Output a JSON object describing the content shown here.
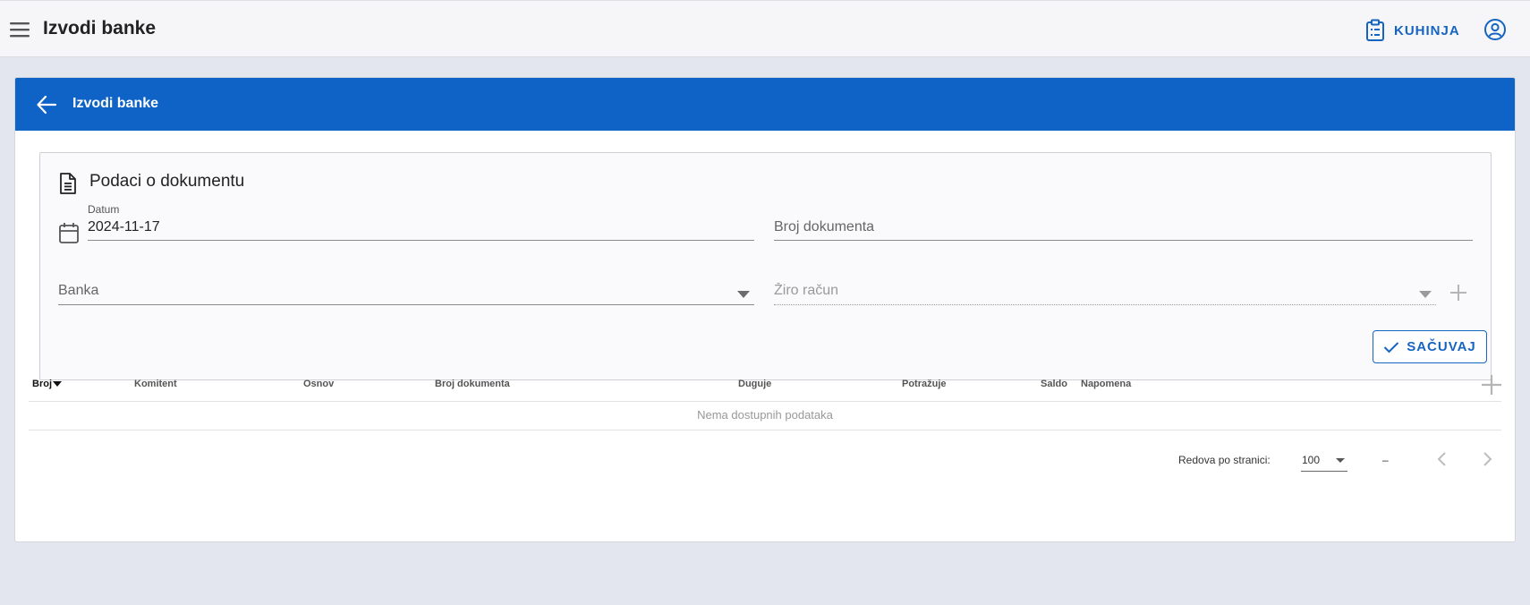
{
  "appbar": {
    "title": "Izvodi banke",
    "location_label": "KUHINJA",
    "icons": {
      "menu": "hamburger-menu-icon",
      "location": "clipboard-list-icon",
      "account": "account-circle-icon"
    }
  },
  "card": {
    "title": "Izvodi banke",
    "back_icon": "arrow-left-icon"
  },
  "document": {
    "title": "Podaci o dokumentu",
    "fields": {
      "datum": {
        "label": "Datum",
        "value": "2024-11-17"
      },
      "broj_dokumenta": {
        "placeholder": "Broj dokumenta",
        "value": ""
      },
      "banka": {
        "placeholder": "Banka",
        "value": ""
      },
      "ziro_racun": {
        "placeholder": "Žiro račun",
        "value": "",
        "disabled": true
      }
    },
    "save_label": "SAČUVAJ"
  },
  "table": {
    "columns": [
      {
        "key": "broj",
        "label": "Broj",
        "sorted": "desc"
      },
      {
        "key": "komitent",
        "label": "Komitent"
      },
      {
        "key": "osnov",
        "label": "Osnov"
      },
      {
        "key": "broj_dokumenta",
        "label": "Broj dokumenta"
      },
      {
        "key": "duguje",
        "label": "Duguje"
      },
      {
        "key": "potrazuje",
        "label": "Potražuje"
      },
      {
        "key": "saldo",
        "label": "Saldo"
      },
      {
        "key": "napomena",
        "label": "Napomena"
      }
    ],
    "rows": [],
    "empty_text": "Nema dostupnih podataka"
  },
  "pagination": {
    "rows_per_page_label": "Redova po stranici:",
    "rows_per_page": "100",
    "page_info": "–"
  },
  "colors": {
    "primary": "#1063c6",
    "accent_text": "#1565c0",
    "background": "#e4e6ef"
  }
}
